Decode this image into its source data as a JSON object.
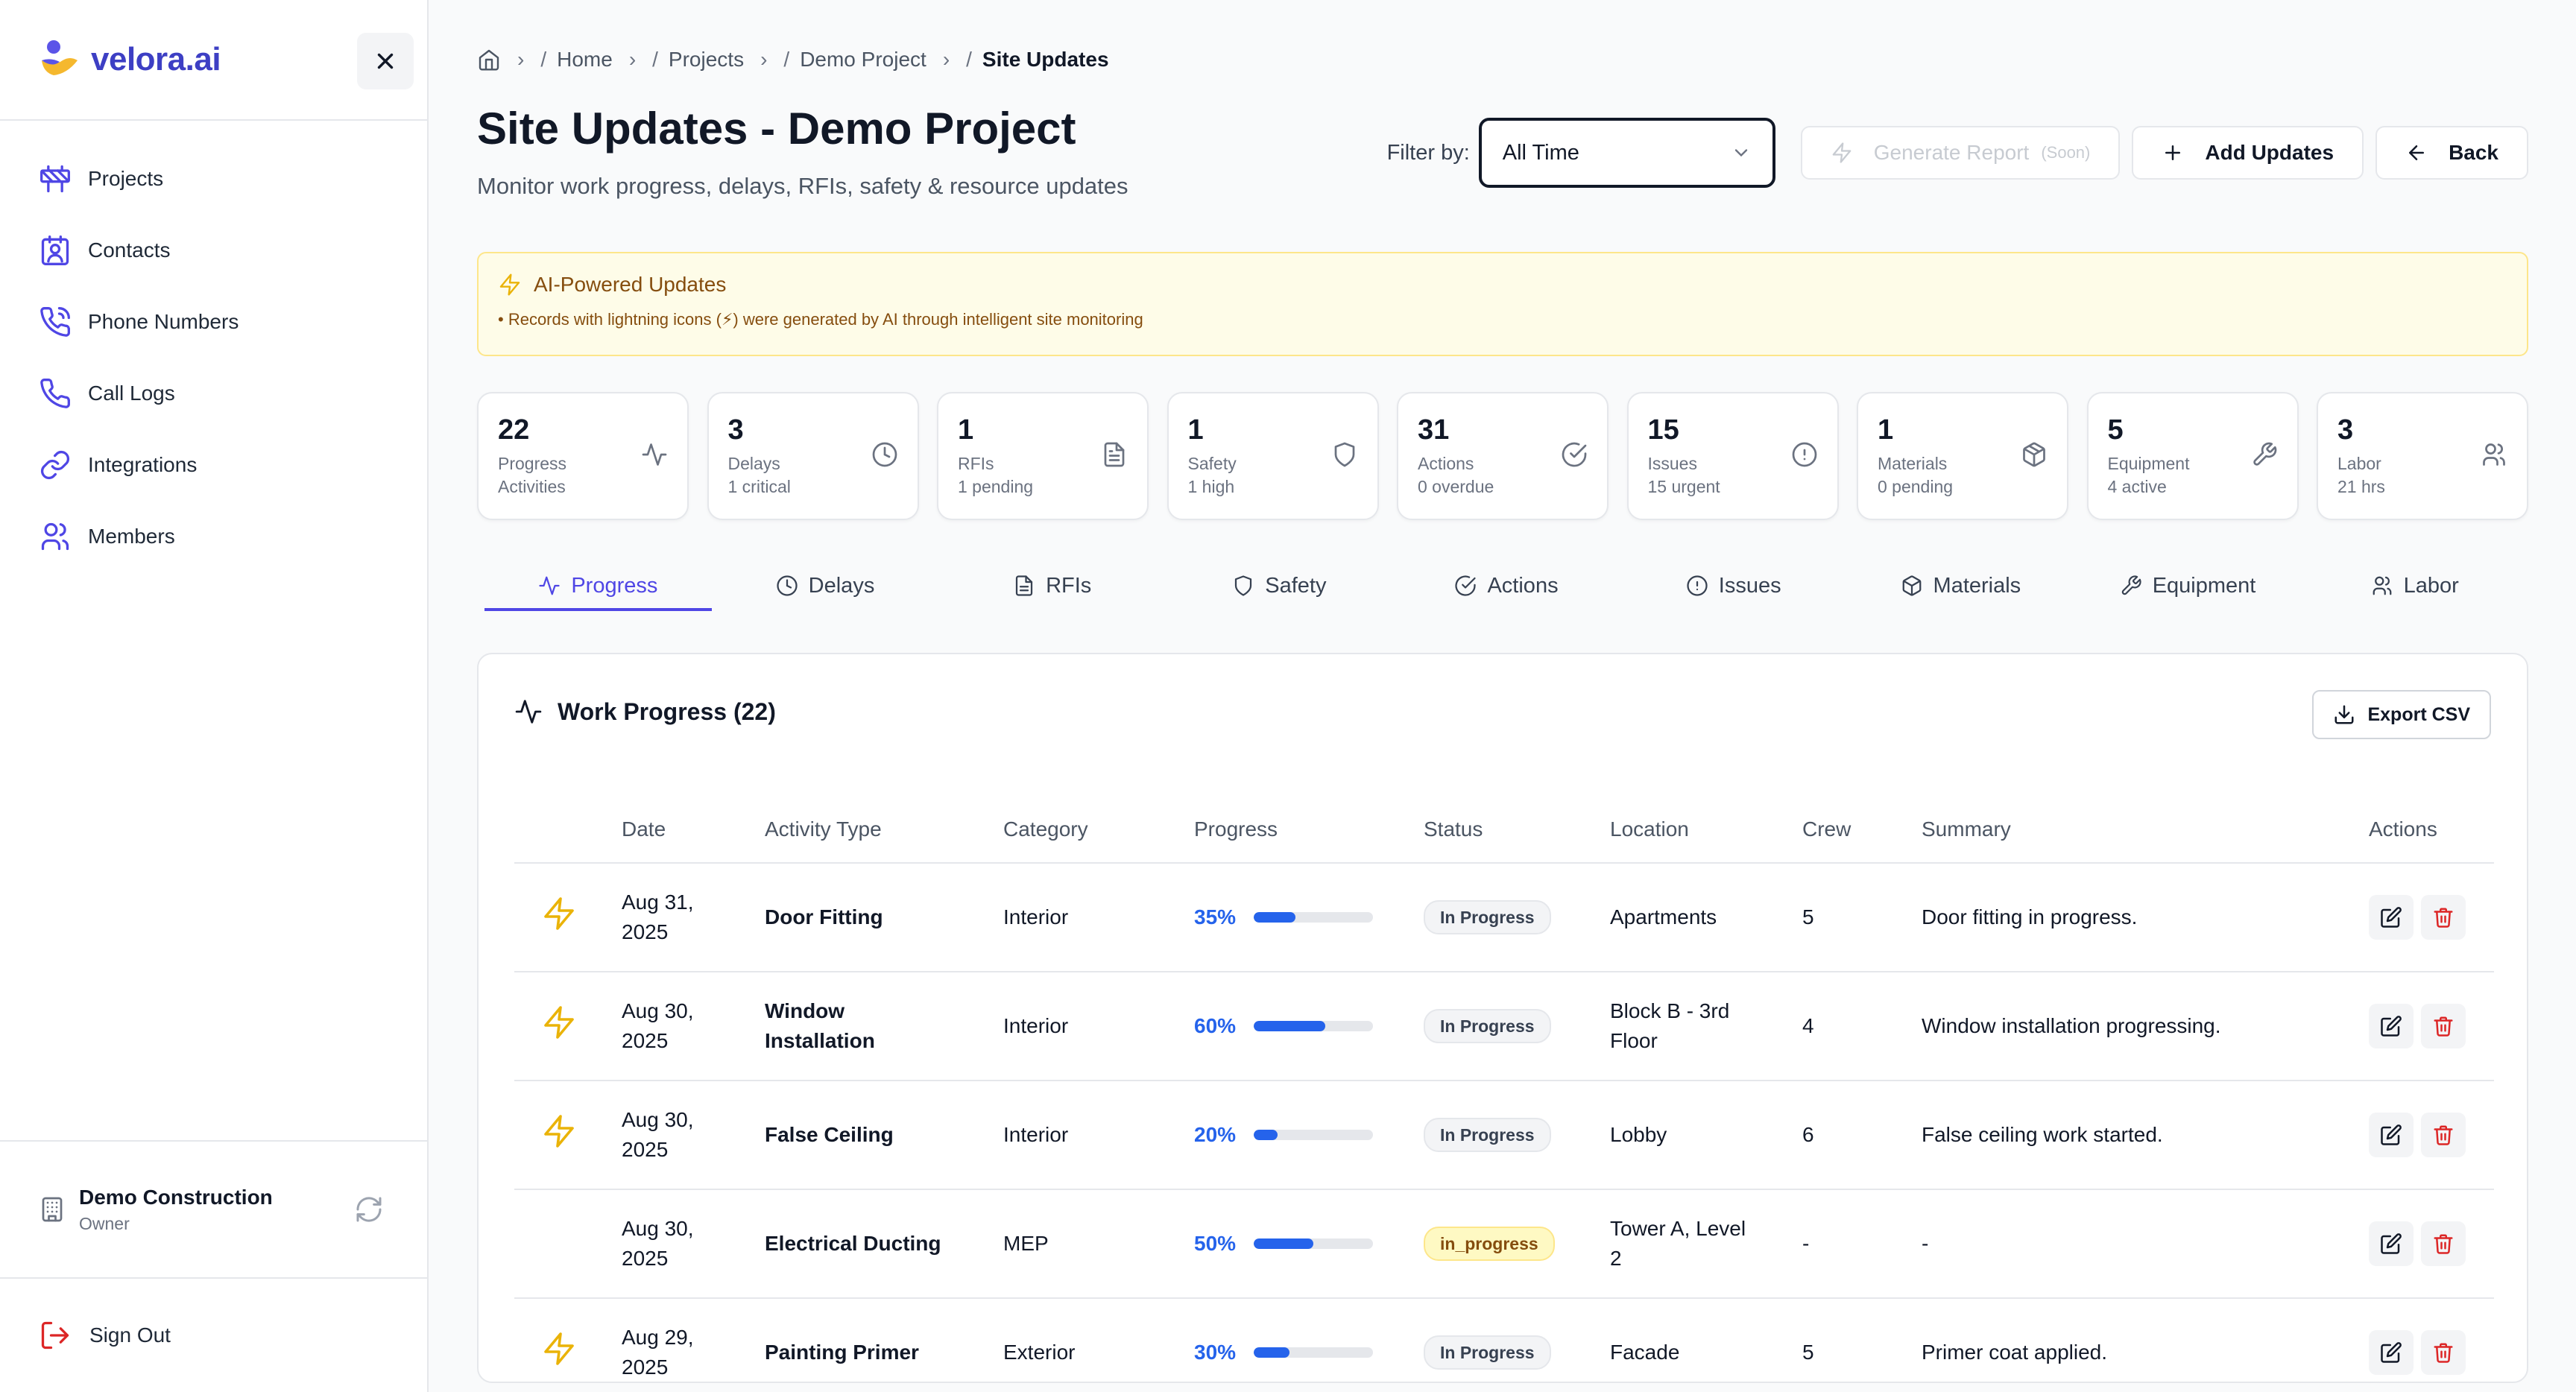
{
  "brand": {
    "name": "velora.ai"
  },
  "sidebar": {
    "items": [
      {
        "label": "Projects",
        "icon": "construction-icon"
      },
      {
        "label": "Contacts",
        "icon": "contact-card-icon"
      },
      {
        "label": "Phone Numbers",
        "icon": "phone-icon"
      },
      {
        "label": "Call Logs",
        "icon": "phone-log-icon"
      },
      {
        "label": "Integrations",
        "icon": "link-icon"
      },
      {
        "label": "Members",
        "icon": "users-icon"
      }
    ],
    "org": {
      "name": "Demo Construction",
      "role": "Owner"
    },
    "sign_out": "Sign Out"
  },
  "breadcrumb": {
    "home": "Home",
    "projects": "Projects",
    "project": "Demo Project",
    "current": "Site Updates"
  },
  "header": {
    "title": "Site Updates - Demo Project",
    "subtitle": "Monitor work progress, delays, RFIs, safety & resource updates",
    "filter_label": "Filter by:",
    "filter_value": "All Time",
    "generate_report": "Generate Report",
    "soon": "(Soon)",
    "add_updates": "Add Updates",
    "back": "Back"
  },
  "ai_banner": {
    "title": "AI-Powered Updates",
    "text": "• Records with lightning icons (⚡) were generated by AI through intelligent site monitoring"
  },
  "stats": [
    {
      "num": "22",
      "label": "Progress",
      "sub": "Activities",
      "icon": "activity-icon"
    },
    {
      "num": "3",
      "label": "Delays",
      "sub": "1 critical",
      "icon": "clock-icon"
    },
    {
      "num": "1",
      "label": "RFIs",
      "sub": "1 pending",
      "icon": "document-icon"
    },
    {
      "num": "1",
      "label": "Safety",
      "sub": "1 high",
      "icon": "shield-icon"
    },
    {
      "num": "31",
      "label": "Actions",
      "sub": "0 overdue",
      "icon": "check-circle-icon"
    },
    {
      "num": "15",
      "label": "Issues",
      "sub": "15 urgent",
      "icon": "alert-circle-icon"
    },
    {
      "num": "1",
      "label": "Materials",
      "sub": "0 pending",
      "icon": "package-icon"
    },
    {
      "num": "5",
      "label": "Equipment",
      "sub": "4 active",
      "icon": "wrench-icon"
    },
    {
      "num": "3",
      "label": "Labor",
      "sub": "21 hrs",
      "icon": "users-icon"
    }
  ],
  "tabs": [
    {
      "label": "Progress",
      "icon": "activity-icon"
    },
    {
      "label": "Delays",
      "icon": "clock-icon"
    },
    {
      "label": "RFIs",
      "icon": "document-icon"
    },
    {
      "label": "Safety",
      "icon": "shield-icon"
    },
    {
      "label": "Actions",
      "icon": "check-circle-icon"
    },
    {
      "label": "Issues",
      "icon": "alert-circle-icon"
    },
    {
      "label": "Materials",
      "icon": "package-icon"
    },
    {
      "label": "Equipment",
      "icon": "wrench-icon"
    },
    {
      "label": "Labor",
      "icon": "users-icon"
    }
  ],
  "card": {
    "title": "Work Progress (22)",
    "export": "Export CSV"
  },
  "table": {
    "headers": [
      "Date",
      "Activity Type",
      "Category",
      "Progress",
      "Status",
      "Location",
      "Crew",
      "Summary",
      "Actions"
    ],
    "rows": [
      {
        "ai": true,
        "date_a": "Aug 31,",
        "date_b": "2025",
        "type_a": "Door Fitting",
        "type_b": "",
        "category": "Interior",
        "progress": "35%",
        "pct": 35,
        "status": "In Progress",
        "status_style": "default",
        "loc_a": "Apartments",
        "loc_b": "",
        "crew": "5",
        "summary": "Door fitting in progress."
      },
      {
        "ai": true,
        "date_a": "Aug 30,",
        "date_b": "2025",
        "type_a": "Window",
        "type_b": "Installation",
        "category": "Interior",
        "progress": "60%",
        "pct": 60,
        "status": "In Progress",
        "status_style": "default",
        "loc_a": "Block B - 3rd",
        "loc_b": "Floor",
        "crew": "4",
        "summary": "Window installation progressing."
      },
      {
        "ai": true,
        "date_a": "Aug 30,",
        "date_b": "2025",
        "type_a": "False Ceiling",
        "type_b": "",
        "category": "Interior",
        "progress": "20%",
        "pct": 20,
        "status": "In Progress",
        "status_style": "default",
        "loc_a": "Lobby",
        "loc_b": "",
        "crew": "6",
        "summary": "False ceiling work started."
      },
      {
        "ai": false,
        "date_a": "Aug 30,",
        "date_b": "2025",
        "type_a": "Electrical Ducting",
        "type_b": "",
        "category": "MEP",
        "progress": "50%",
        "pct": 50,
        "status": "in_progress",
        "status_style": "warn",
        "loc_a": "Tower A, Level",
        "loc_b": "2",
        "crew": "-",
        "summary": "-"
      },
      {
        "ai": true,
        "date_a": "Aug 29,",
        "date_b": "2025",
        "type_a": "Painting Primer",
        "type_b": "",
        "category": "Exterior",
        "progress": "30%",
        "pct": 30,
        "status": "In Progress",
        "status_style": "default",
        "loc_a": "Facade",
        "loc_b": "",
        "crew": "5",
        "summary": "Primer coat applied."
      }
    ]
  },
  "colors": {
    "accent": "#4f46e5",
    "brand": "#3d3fc4",
    "progress": "#2563eb",
    "ai_bolt": "#eab308",
    "delete": "#dc2626"
  }
}
